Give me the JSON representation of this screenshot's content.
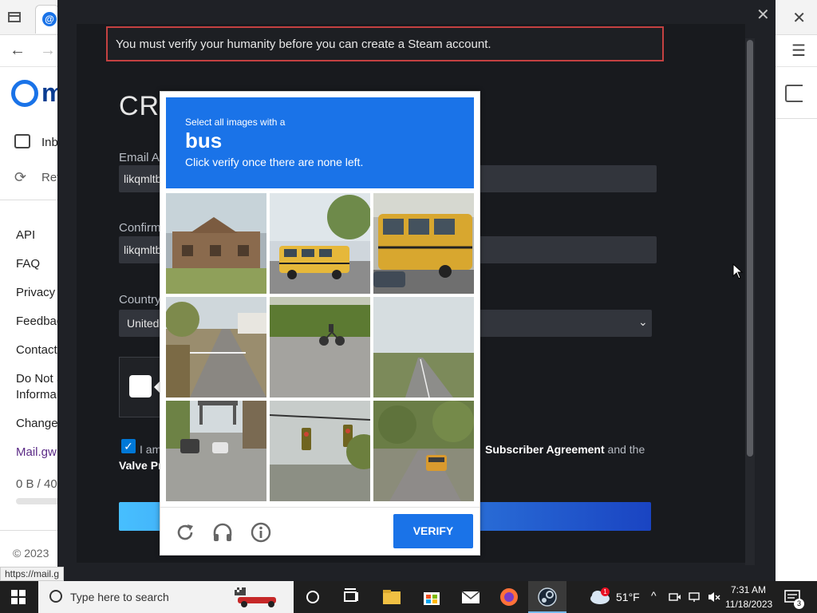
{
  "browser": {
    "status_url": "https://mail.g"
  },
  "mail": {
    "logo_letter": "m",
    "nav_inbox": "Inbo",
    "nav_refresh": "Ref",
    "sidebar_links": [
      "API",
      "FAQ",
      "Privacy",
      "Feedbac",
      "Contact",
      "Do Not S",
      "Informa",
      "Change",
      "Mail.gw"
    ],
    "storage": "0 B  / 40",
    "copyright": "© 2023"
  },
  "steam": {
    "error_message": "You must verify your humanity before you can create a Steam account.",
    "heading": "CRE",
    "email_label": "Email Ad",
    "email_value": "likqmltb",
    "confirm_label": "Confirm",
    "confirm_value": "likqmltb",
    "country_label": "Country",
    "country_value": "United",
    "agree_prefix": "I am",
    "agree_link_text": "Subscriber Agreement",
    "agree_suffix": " and the",
    "agree_line2": "Valve Pr"
  },
  "captcha": {
    "instruction_small": "Select all images with a",
    "target_word": "bus",
    "instruction_sub": "Click verify once there are none left.",
    "verify_label": "VERIFY",
    "tiles": [
      "building",
      "school-bus",
      "school-bus-closeup",
      "street-houses",
      "cyclist-on-road",
      "road-with-fields",
      "street-with-cars",
      "traffic-lights",
      "bus-in-street"
    ]
  },
  "taskbar": {
    "search_placeholder": "Type here to search",
    "weather_temp": "51°F",
    "weather_badge": "1",
    "time": "7:31 AM",
    "date": "11/18/2023",
    "notification_count": "3"
  }
}
